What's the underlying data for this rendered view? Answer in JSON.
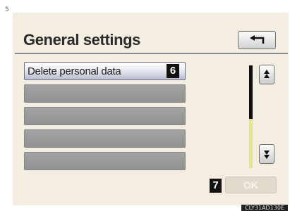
{
  "page_marker": "5",
  "header": {
    "title": "General settings",
    "back_icon": "back-arrow-icon"
  },
  "list": {
    "items": [
      {
        "label": "Delete personal data",
        "callout": "6"
      },
      {
        "label": ""
      },
      {
        "label": ""
      },
      {
        "label": ""
      },
      {
        "label": ""
      }
    ]
  },
  "scroll": {
    "up_icon": "scroll-up-icon",
    "down_icon": "scroll-down-icon",
    "position_fraction": 0.48
  },
  "footer": {
    "callout": "7",
    "ok_label": "OK"
  },
  "image_code": "CLY31AD130E",
  "colors": {
    "screen_background": "#f3ede2",
    "inactive_row": "#999999",
    "scroll_fill": "#e7e787",
    "callout_background": "#121212"
  }
}
